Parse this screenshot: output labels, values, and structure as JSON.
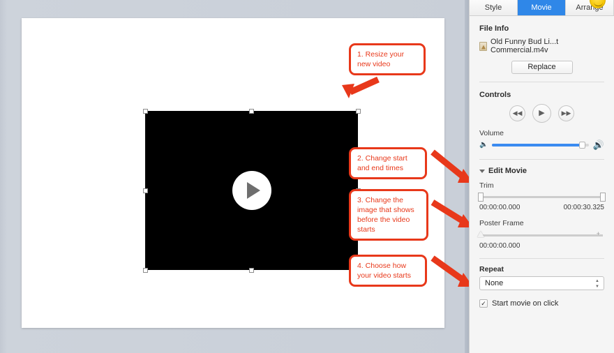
{
  "inspector": {
    "tabs": [
      {
        "label": "Style",
        "active": false
      },
      {
        "label": "Movie",
        "active": true
      },
      {
        "label": "Arrange",
        "active": false
      }
    ],
    "file_info": {
      "heading": "File Info",
      "filename": "Old Funny Bud Li...t Commercial.m4v",
      "file_icon": "movie-file-icon",
      "replace_label": "Replace"
    },
    "controls": {
      "heading": "Controls",
      "rewind_icon": "◀◀",
      "play_icon": "▶",
      "forward_icon": "▶▶",
      "volume_label": "Volume",
      "volume_low_icon": "🔈",
      "volume_high_icon": "🔊",
      "volume_value": 93
    },
    "edit_movie": {
      "heading": "Edit Movie",
      "expanded": true,
      "trim_label": "Trim",
      "trim_start": "00:00:00.000",
      "trim_end": "00:00:30.325",
      "poster_label": "Poster Frame",
      "poster_time": "00:00:00.000",
      "repeat_label": "Repeat",
      "repeat_value": "None",
      "start_on_click_label": "Start movie on click",
      "start_on_click_checked": true,
      "check_glyph": "✓"
    }
  },
  "canvas": {
    "video_play_icon": "play-triangle",
    "selected": true
  },
  "callouts": [
    {
      "id": "callout-1",
      "text": "1. Resize your new video"
    },
    {
      "id": "callout-2",
      "text": "2. Change start and end times"
    },
    {
      "id": "callout-3",
      "text": "3. Change the image that shows before the video starts"
    },
    {
      "id": "callout-4",
      "text": "4. Choose how your video starts"
    }
  ],
  "colors": {
    "accent_blue": "#2f87e8",
    "annotation_red": "#e8381a",
    "volume_blue": "#3b8bf0",
    "canvas_bg": "#c9cfd8"
  }
}
